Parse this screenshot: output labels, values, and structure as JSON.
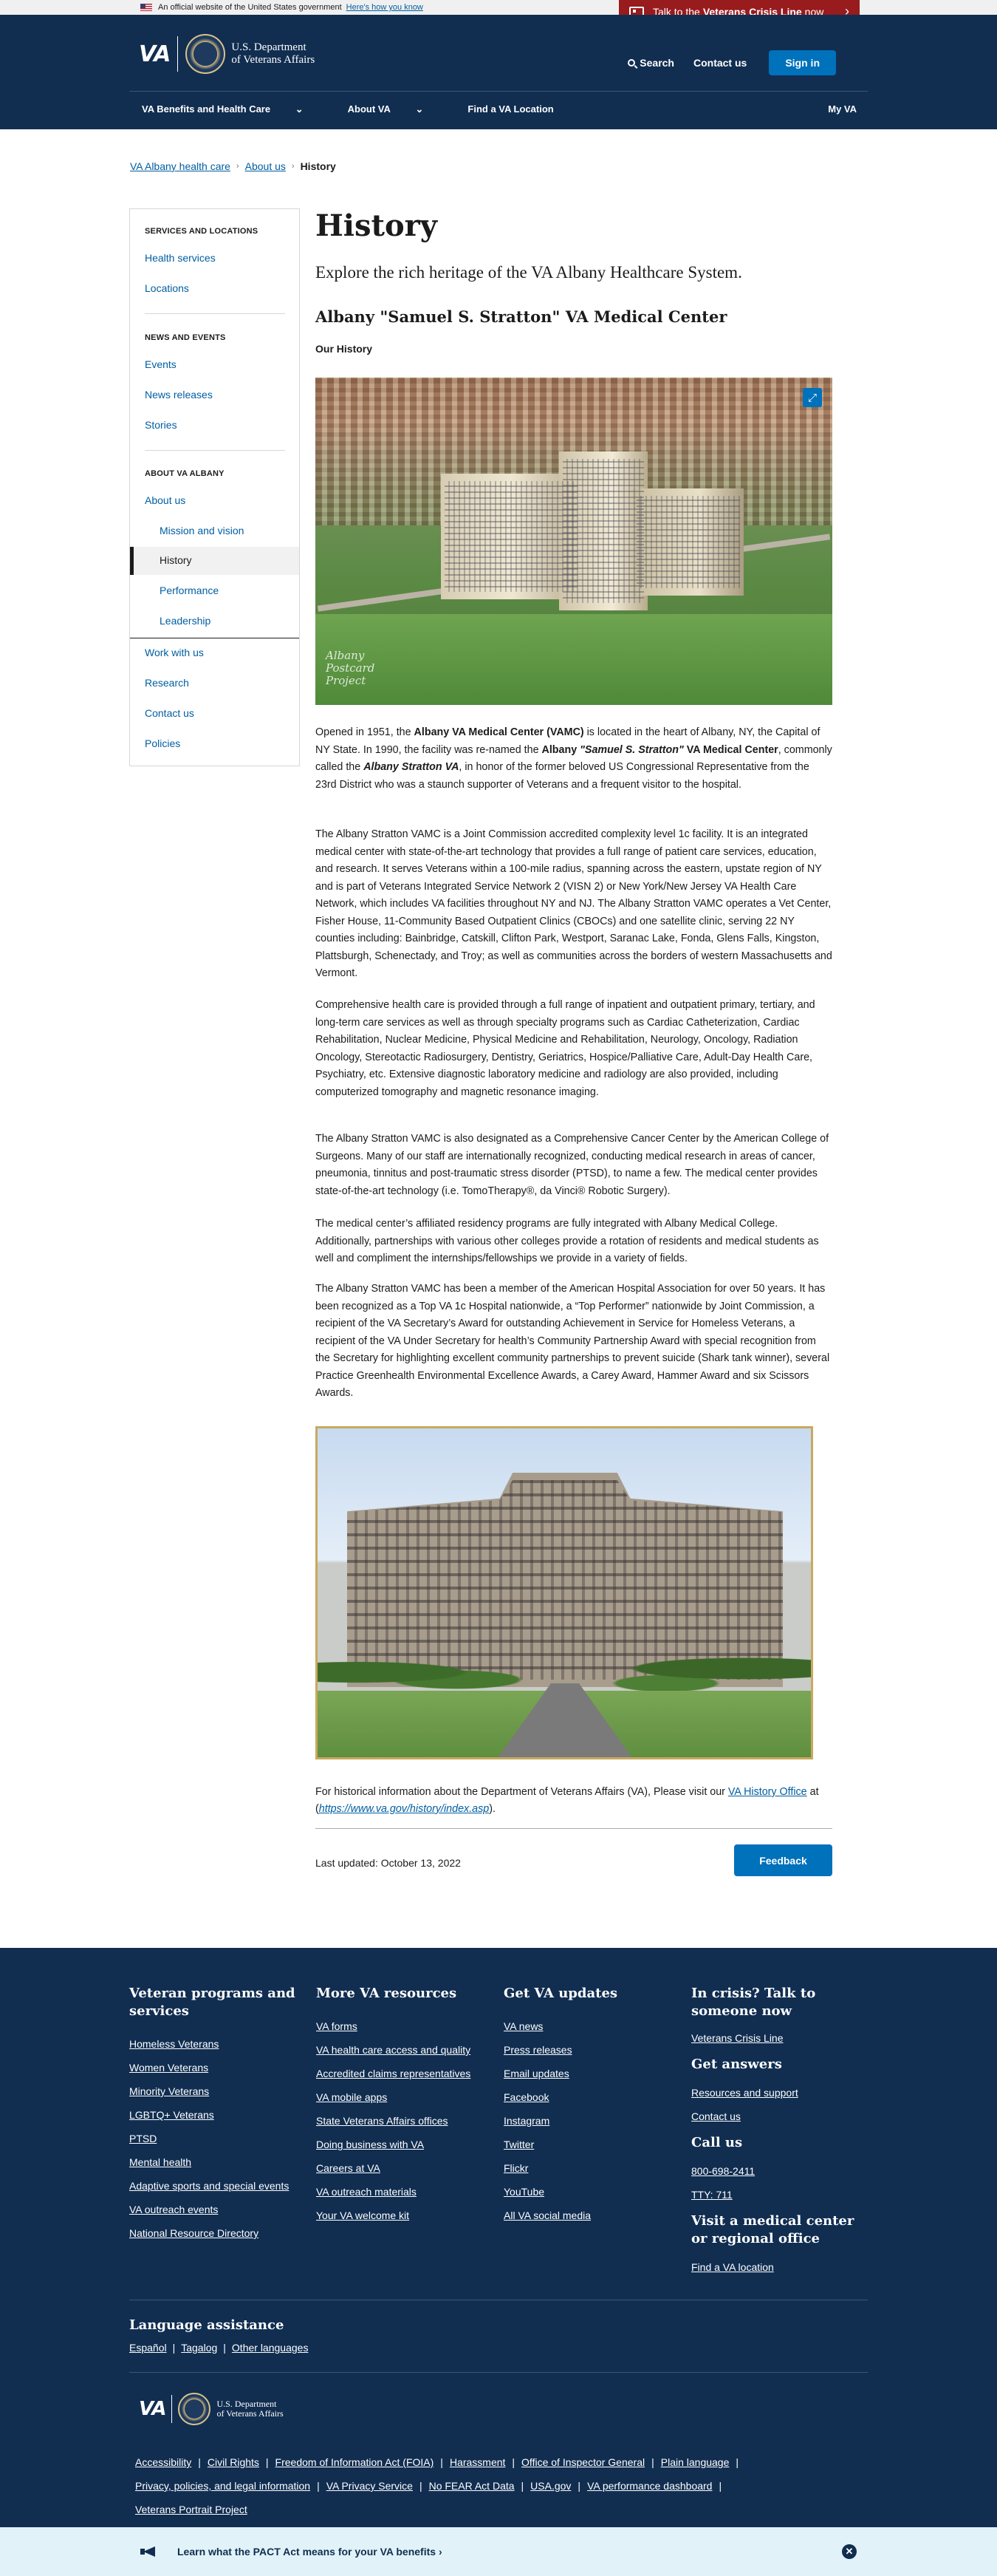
{
  "banner": {
    "official_text": "An official website of the United States government",
    "know_link": "Here's how you know",
    "crisis_pre": "Talk to the",
    "crisis_bold": "Veterans Crisis Line",
    "crisis_post": "now"
  },
  "header": {
    "logo": "VA",
    "dept_line1": "U.S. Department",
    "dept_line2": "of Veterans Affairs",
    "search": "Search",
    "contact": "Contact us",
    "signin": "Sign in",
    "nav": [
      "VA Benefits and Health Care",
      "About VA",
      "Find a VA Location"
    ],
    "myva": "My VA"
  },
  "breadcrumb": [
    "VA Albany health care",
    "About us",
    "History"
  ],
  "sidebar": {
    "sections": [
      {
        "heading": "SERVICES AND LOCATIONS",
        "links": [
          "Health services",
          "Locations"
        ]
      },
      {
        "heading": "NEWS AND EVENTS",
        "links": [
          "Events",
          "News releases",
          "Stories"
        ]
      },
      {
        "heading": "ABOUT VA ALBANY",
        "links": [
          "About us",
          "Mission and vision",
          "History",
          "Performance",
          "Leadership",
          "Work with us",
          "Research",
          "Contact us",
          "Policies"
        ]
      }
    ]
  },
  "main": {
    "title": "History",
    "intro": "Explore the rich heritage of the VA Albany Healthcare System.",
    "subtitle": "Albany \"Samuel S. Stratton\" VA Medical Center",
    "section_label": "Our History",
    "photo1_watermark": [
      "Albany",
      "Postcard",
      "Project"
    ],
    "paragraphs": {
      "p1_a": "Opened in 1951, the ",
      "p1_b": "Albany VA Medical Center (VAMC)",
      "p1_c": " is located in the heart of Albany, NY, the Capital of NY State. In 1990, the facility was re-named the ",
      "p1_d": "Albany ",
      "p1_e": "\"Samuel S. Stratton\"",
      "p1_f": " VA Medical Center",
      "p1_g": ", commonly called the ",
      "p1_h": "Albany Stratton VA",
      "p1_i": ", in honor of the former beloved US Congressional Representative from the 23rd District who was a staunch supporter of Veterans and a frequent visitor to the hospital.",
      "p2": "The Albany Stratton VAMC is a Joint Commission accredited complexity level 1c facility. It is an integrated medical center with state-of-the-art technology that provides a full range of patient care services, education, and research.  It serves Veterans within a 100-mile radius, spanning across the eastern, upstate region of NY and is part of Veterans Integrated Service Network 2 (VISN 2) or New York/New Jersey VA Health Care Network, which includes VA facilities throughout NY and NJ. The Albany Stratton VAMC operates a Vet Center, Fisher House, 11-Community Based Outpatient Clinics (CBOCs) and one satellite clinic, serving 22 NY counties including: Bainbridge, Catskill, Clifton Park, Westport, Saranac Lake, Fonda, Glens Falls, Kingston, Plattsburgh, Schenectady, and Troy; as well as communities across the borders of western Massachusetts and Vermont.",
      "p3": "Comprehensive health care is provided through a full range of inpatient and outpatient primary, tertiary, and long-term care services as well as through specialty programs such as Cardiac Catheterization, Cardiac Rehabilitation, Nuclear Medicine, Physical Medicine and Rehabilitation, Neurology, Oncology, Radiation Oncology, Stereotactic Radiosurgery, Dentistry, Geriatrics, Hospice/Palliative Care, Adult-Day Health Care, Psychiatry, etc. Extensive diagnostic laboratory medicine and radiology are also provided, including computerized tomography and magnetic resonance imaging.",
      "p4": "The Albany Stratton VAMC is also designated as a Comprehensive Cancer Center by the American College of Surgeons. Many of our staff are internationally recognized, conducting medical research in areas of cancer, pneumonia, tinnitus and post-traumatic stress disorder (PTSD), to name a few. The medical center provides state-of-the-art technology (i.e. TomoTherapy®, da Vinci® Robotic Surgery).",
      "p5": "The medical center’s affiliated residency programs are fully integrated with Albany Medical College. Additionally, partnerships with various other colleges provide a rotation of residents and medical students as well and compliment the internships/fellowships we provide in a variety of fields.",
      "p6": "The Albany Stratton VAMC has been a member of the American Hospital Association for over 50 years. It has been recognized as a Top VA 1c Hospital nationwide, a “Top Performer” nationwide by Joint Commission, a recipient of the VA Secretary’s Award for outstanding Achievement in Service for Homeless Veterans, a recipient of the VA Under Secretary for health’s Community Partnership Award with special recognition from the Secretary for highlighting excellent community partnerships to prevent suicide (Shark tank winner), several Practice Greenhealth Environmental Excellence Awards, a Carey Award, Hammer Award and six Scissors Awards."
    },
    "history_note_a": "For historical information about the Department of Veterans Affairs (VA), Please visit our ",
    "history_note_link": "VA History Office",
    "history_note_b": " at (",
    "history_note_url": "https://www.va.gov/history/index.asp",
    "history_note_c": ").",
    "last_updated": "Last updated: October 13, 2022",
    "feedback": "Feedback"
  },
  "footer": {
    "col1_title": "Veteran programs and services",
    "col1_links": [
      "Homeless Veterans",
      "Women Veterans",
      "Minority Veterans",
      "LGBTQ+ Veterans",
      "PTSD",
      "Mental health",
      "Adaptive sports and special events",
      "VA outreach events",
      "National Resource Directory"
    ],
    "col2_title": "More VA resources",
    "col2_links": [
      "VA forms",
      "VA health care access and quality",
      "Accredited claims representatives",
      "VA mobile apps",
      "State Veterans Affairs offices",
      "Doing business with VA",
      "Careers at VA",
      "VA outreach materials",
      "Your VA welcome kit"
    ],
    "col3_title": "Get VA updates",
    "col3_links": [
      "VA news",
      "Press releases",
      "Email updates",
      "Facebook",
      "Instagram",
      "Twitter",
      "Flickr",
      "YouTube",
      "All VA social media"
    ],
    "col4_crisis_title": "In crisis? Talk to someone now",
    "col4_crisis_link": "Veterans Crisis Line",
    "col4_answers_title": "Get answers",
    "col4_answers_links": [
      "Resources and support",
      "Contact us"
    ],
    "col4_call_title": "Call us",
    "col4_call_links": [
      "800-698-2411",
      "TTY: 711"
    ],
    "col4_visit_title": "Visit a medical center or regional office",
    "col4_visit_link": "Find a VA location",
    "lang_title": "Language assistance",
    "lang_links": [
      "Español",
      "Tagalog",
      "Other languages"
    ],
    "legal_links": [
      "Accessibility",
      "Civil Rights",
      "Freedom of Information Act (FOIA)",
      "Harassment",
      "Office of Inspector General",
      "Plain language",
      "Privacy, policies, and legal information",
      "VA Privacy Service",
      "No FEAR Act Data",
      "USA.gov",
      "VA performance dashboard",
      "Veterans Portrait Project"
    ]
  },
  "pact": {
    "text": "Learn what the PACT Act means for your VA benefits",
    "arrow": "›"
  }
}
